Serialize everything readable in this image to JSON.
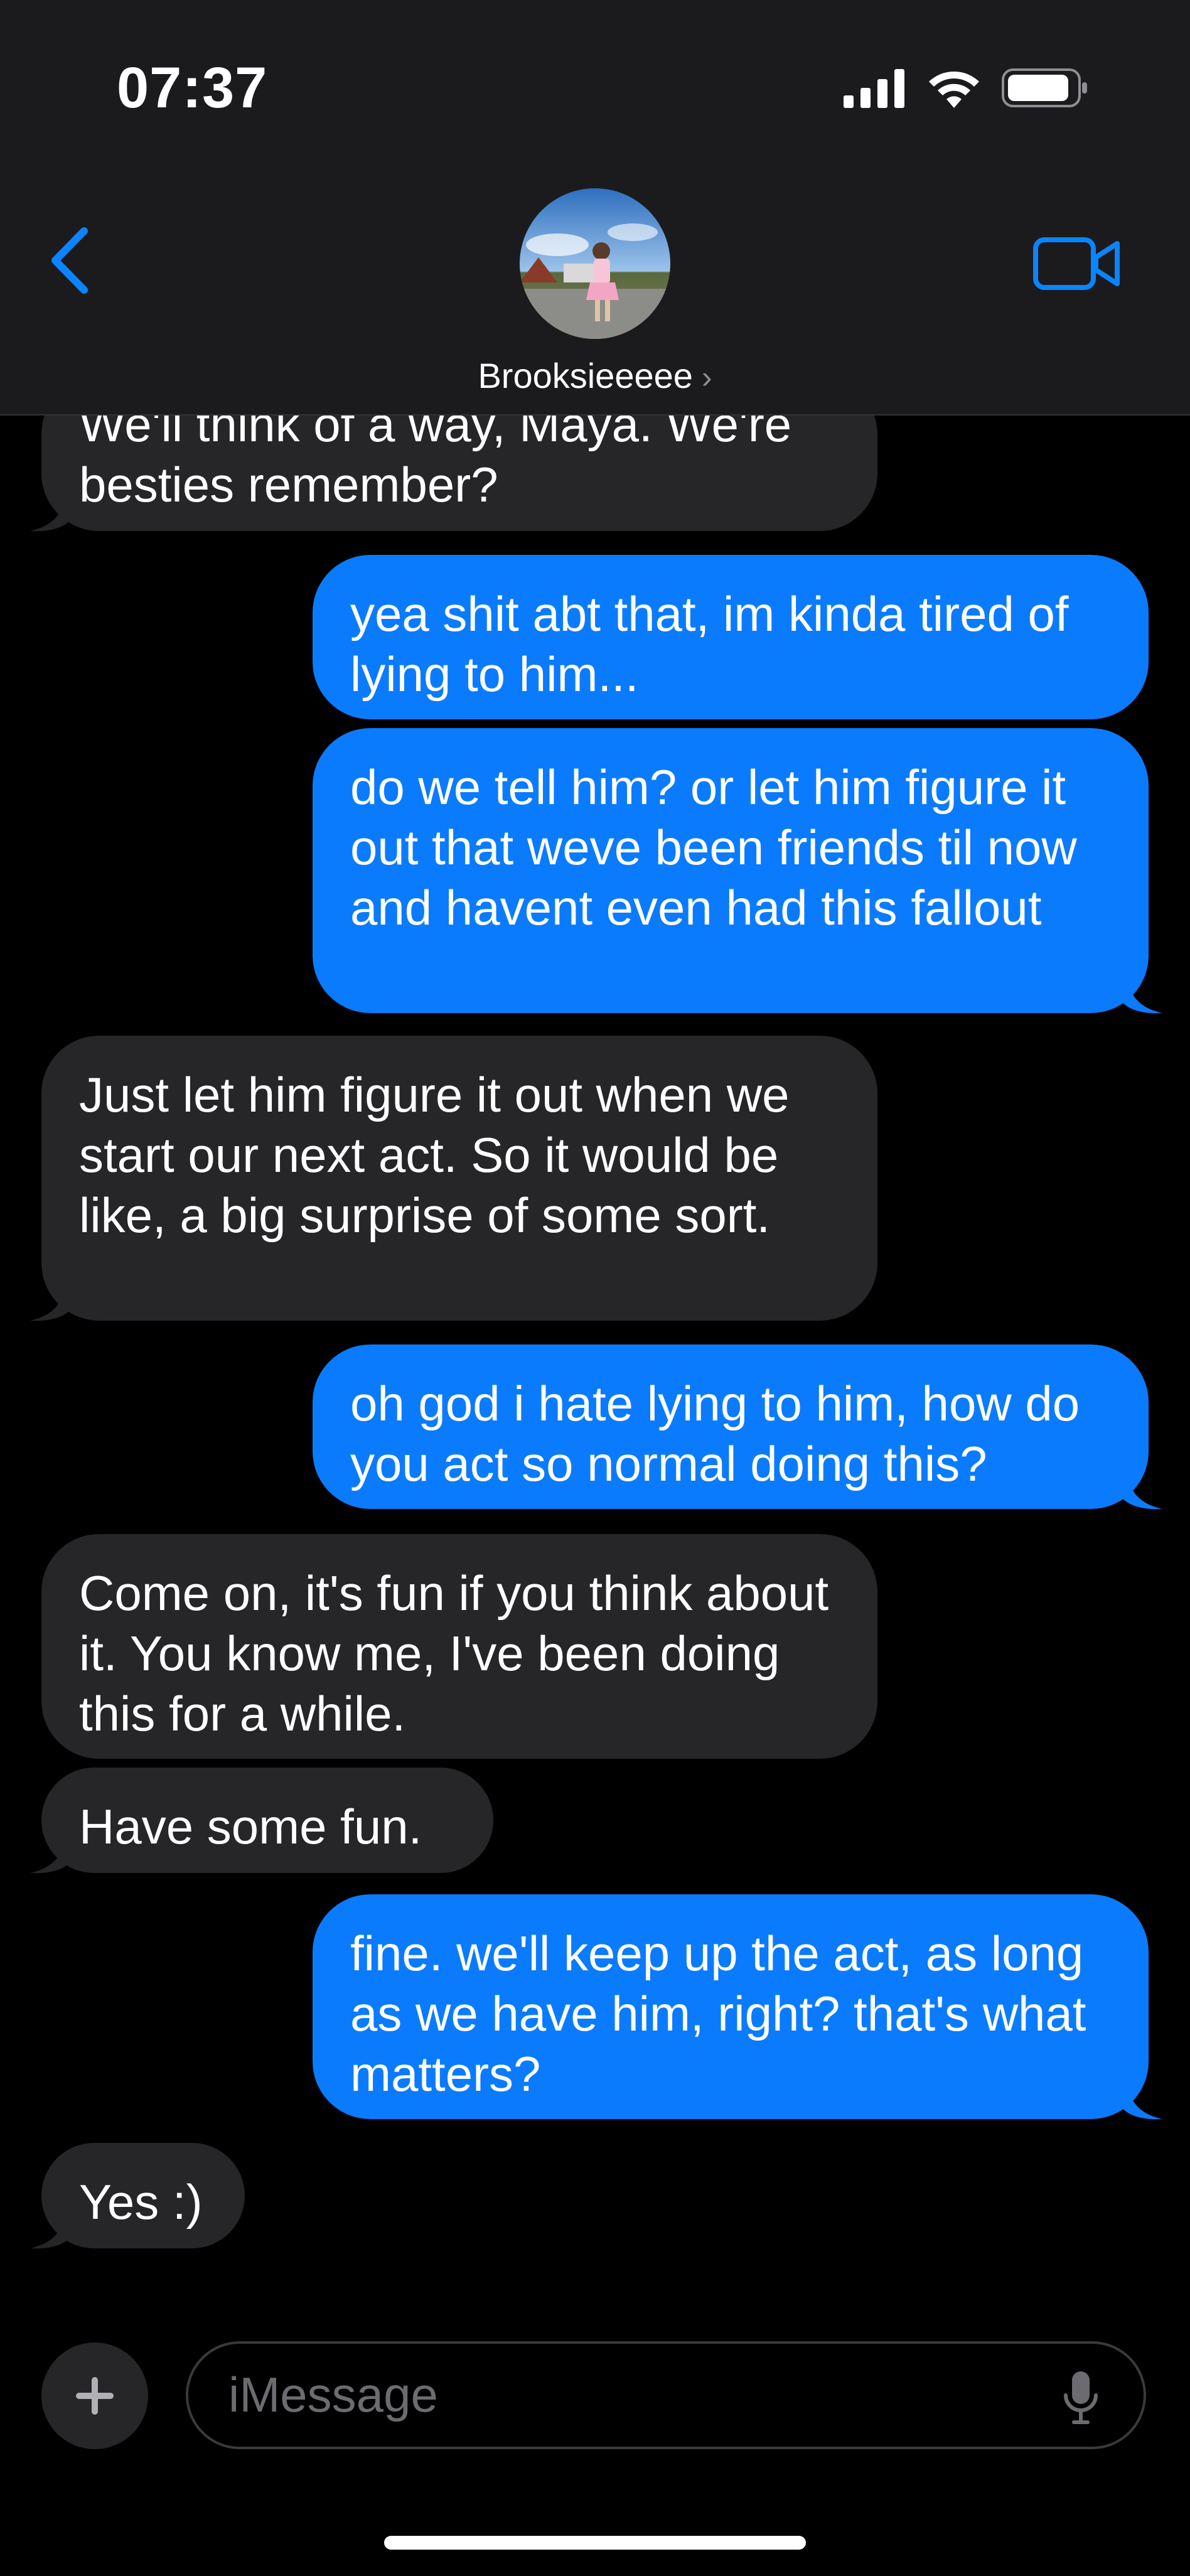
{
  "status_bar": {
    "time": "07:37"
  },
  "header": {
    "contact_name": "Brooksieeeee",
    "chevron": "›"
  },
  "messages": [
    {
      "direction": "in",
      "text": "We'll think of a way, Maya. We're besties remember?"
    },
    {
      "direction": "out",
      "text": "yea shit abt that, im kinda tired of lying to him..."
    },
    {
      "direction": "out",
      "text": "do we tell him? or let him figure it out that weve been friends til now and havent even had this fallout"
    },
    {
      "direction": "in",
      "text": "Just let him figure it out when we start our next act. So it would be like, a big surprise of some sort."
    },
    {
      "direction": "out",
      "text": "oh god i hate lying to him, how do you act so normal doing this?"
    },
    {
      "direction": "in",
      "text": "Come on, it's fun if you think about it. You know me, I've been doing this for a while."
    },
    {
      "direction": "in",
      "text": "Have some fun."
    },
    {
      "direction": "out",
      "text": "fine. we'll keep up the act, as long as we have him, right? that's what matters?"
    },
    {
      "direction": "in",
      "text": "Yes :)"
    }
  ],
  "composer": {
    "placeholder": "iMessage"
  },
  "colors": {
    "outgoing": "#0b7bfe",
    "incoming": "#262628",
    "accent": "#0a84ff"
  }
}
